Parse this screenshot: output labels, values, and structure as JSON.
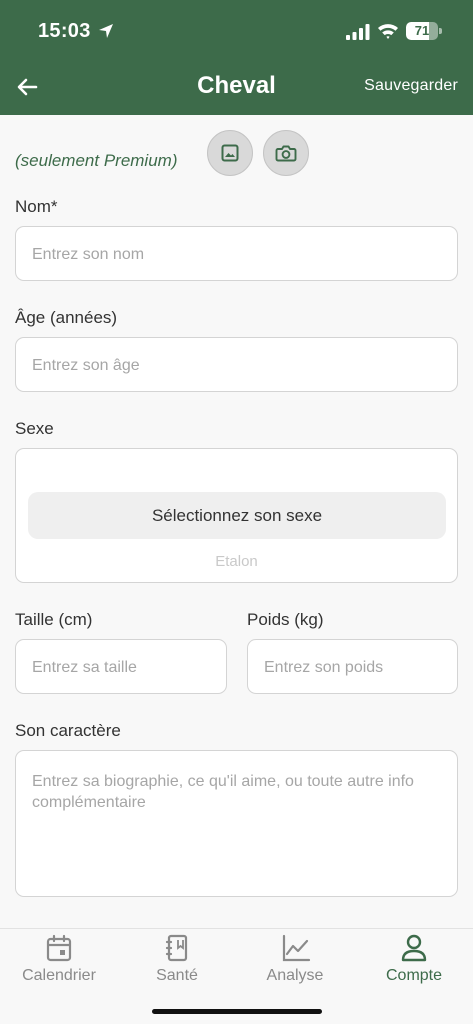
{
  "status_bar": {
    "time": "15:03",
    "battery": "71",
    "battery_level": 0.71
  },
  "header": {
    "title": "Cheval",
    "save_label": "Sauvegarder"
  },
  "photo": {
    "premium_note": "(seulement Premium)"
  },
  "form": {
    "name": {
      "label": "Nom*",
      "placeholder": "Entrez son nom"
    },
    "age": {
      "label": "Âge (années)",
      "placeholder": "Entrez son âge"
    },
    "sex": {
      "label": "Sexe",
      "selected": "Sélectionnez son sexe",
      "next_option": "Etalon"
    },
    "height": {
      "label": "Taille (cm)",
      "placeholder": "Entrez sa taille"
    },
    "weight": {
      "label": "Poids (kg)",
      "placeholder": "Entrez son poids"
    },
    "bio": {
      "label": "Son caractère",
      "placeholder": "Entrez sa biographie, ce qu'il aime, ou toute autre info complémentaire"
    }
  },
  "tabbar": {
    "items": [
      {
        "label": "Calendrier",
        "icon": "calendar-icon",
        "active": false
      },
      {
        "label": "Santé",
        "icon": "notebook-icon",
        "active": false
      },
      {
        "label": "Analyse",
        "icon": "chart-icon",
        "active": false
      },
      {
        "label": "Compte",
        "icon": "user-icon",
        "active": true
      }
    ]
  },
  "colors": {
    "brand": "#3d6b4a",
    "background": "#f8f8f8",
    "inactive": "#8a8a8a"
  }
}
